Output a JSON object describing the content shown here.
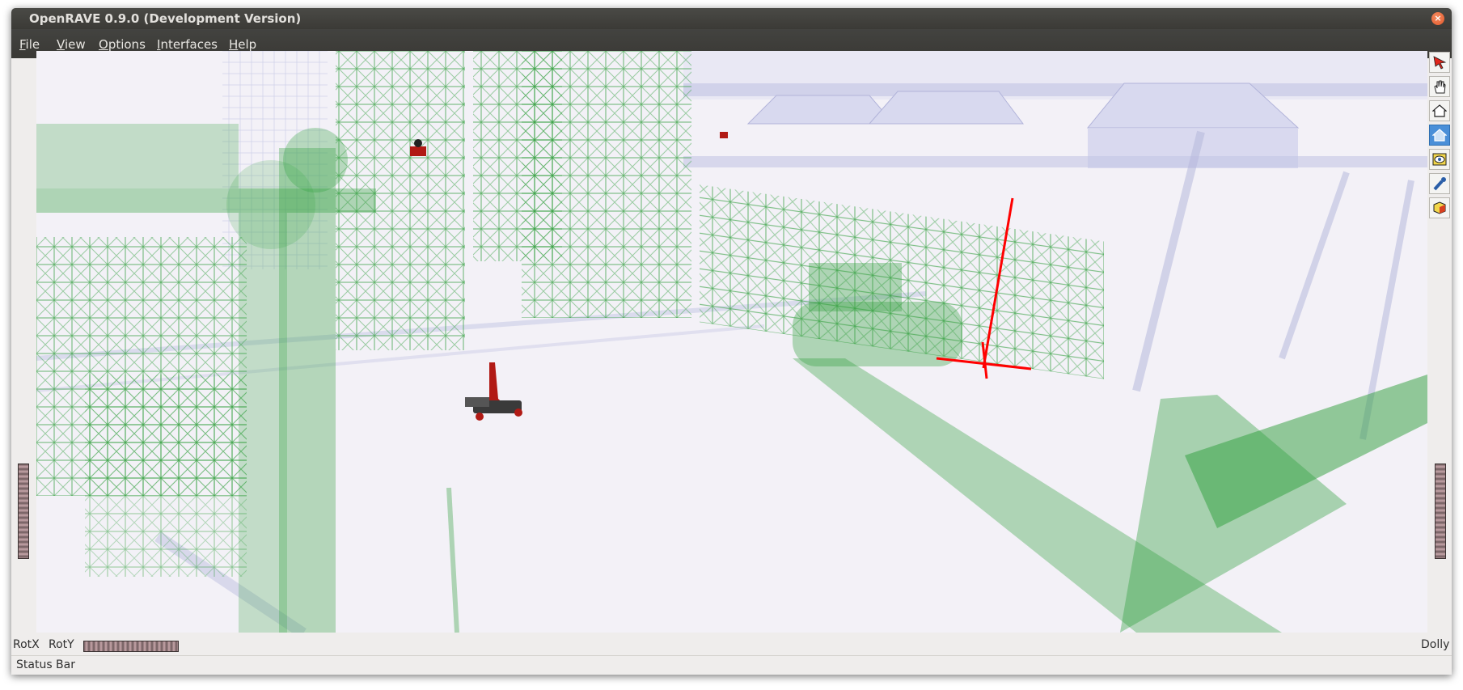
{
  "window": {
    "title": "OpenRAVE 0.9.0 (Development Version)",
    "close_glyph": "×"
  },
  "menu": [
    {
      "label": "File",
      "mnemonic": "F",
      "rest": "ile"
    },
    {
      "label": "View",
      "mnemonic": "V",
      "rest": "iew"
    },
    {
      "label": "Options",
      "mnemonic": "O",
      "rest": "ptions"
    },
    {
      "label": "Interfaces",
      "mnemonic": "I",
      "rest": "nterfaces"
    },
    {
      "label": "Help",
      "mnemonic": "H",
      "rest": "elp"
    }
  ],
  "toolbar": [
    {
      "name": "select-arrow-icon",
      "active": false
    },
    {
      "name": "pan-hand-icon",
      "active": false
    },
    {
      "name": "home-icon",
      "active": false
    },
    {
      "name": "set-home-icon",
      "active": true
    },
    {
      "name": "view-all-eye-icon",
      "active": false
    },
    {
      "name": "seek-flashlight-icon",
      "active": false
    },
    {
      "name": "projection-cube-icon",
      "active": false
    }
  ],
  "wheels": {
    "rotx_label": "RotX",
    "roty_label": "RotY",
    "dolly_label": "Dolly"
  },
  "status": {
    "text": "Status Bar"
  },
  "scene": {
    "background_color": "#f3f1f7",
    "shelf_color": "#2e9e3a",
    "building_color": "#9c9fd0",
    "axis_color": "#ff0000"
  }
}
